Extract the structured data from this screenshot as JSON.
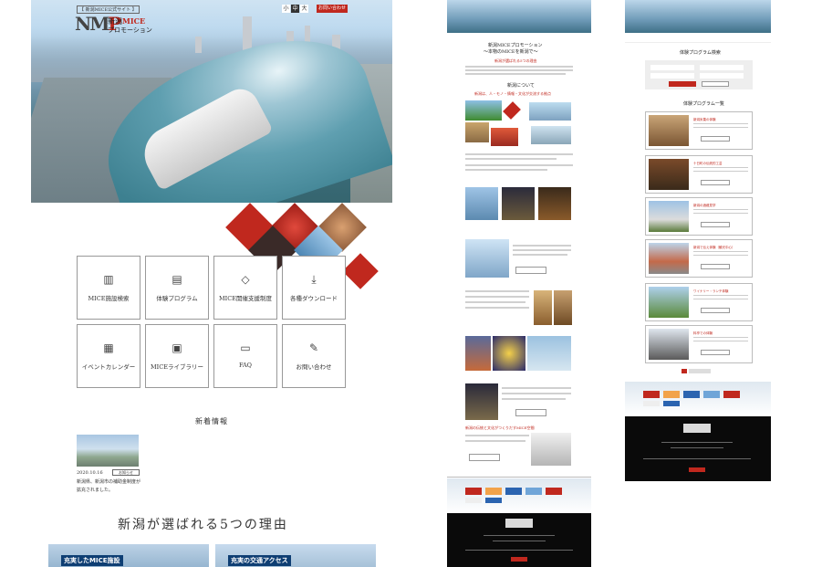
{
  "header": {
    "tagline": "【 新潟MICE公式サイト 】",
    "logo_mark": "NM",
    "logo_mark_accent": "P",
    "logo_title_pre": "新潟",
    "logo_title_accent": "MICE",
    "logo_subtitle": "プロモーション",
    "font_sizes": [
      "小",
      "中",
      "大"
    ],
    "font_size_selected": "中",
    "contact_button": "お問い合わせ"
  },
  "menu": [
    {
      "label": "MICE施設検索",
      "icon": "building-icon"
    },
    {
      "label": "体験プログラム",
      "icon": "program-icon"
    },
    {
      "label": "MICE開催支援制度",
      "icon": "handshake-icon"
    },
    {
      "label": "各種ダウンロード",
      "icon": "download-icon"
    },
    {
      "label": "イベントカレンダー",
      "icon": "calendar-icon"
    },
    {
      "label": "MICEライブラリー",
      "icon": "library-icon"
    },
    {
      "label": "FAQ",
      "icon": "faq-icon"
    },
    {
      "label": "お問い合わせ",
      "icon": "contact-icon"
    }
  ],
  "news": {
    "title": "新着情報",
    "items": [
      {
        "date": "2020.10.16",
        "badge": "お知らせ",
        "text": "新潟県、新潟市の補助金制度が拡充されました。"
      }
    ]
  },
  "reasons": {
    "title": "新潟が選ばれる5つの理由",
    "cards": [
      "充実したMICE施設",
      "充実の交通アクセス"
    ]
  },
  "thumb1": {
    "title_line1": "新潟MICEプロモーション",
    "title_line2": "〜本物のMICEを新潟で〜",
    "red_heading": "新潟が選ばれる5つの理由",
    "section": "新潟について",
    "red_caption": "新潟は、人・モノ・情報・文化が交流する拠点",
    "link_red": "新潟の伝統と文化がつくりだすMICE空間"
  },
  "thumb2": {
    "title": "体験プログラム検索",
    "list_title": "体験プログラム一覧",
    "items": [
      "新潟米菓の体験",
      "十日町の伝統的工芸",
      "新潟の酒蔵見学",
      "新潟で伝え体験（観光中心）",
      "ワイナリー・ランチ体験",
      "料亭での体験"
    ]
  },
  "colors": {
    "accent": "#c0281e",
    "navy": "#0e3e73",
    "footer": "#0a0a0a"
  }
}
